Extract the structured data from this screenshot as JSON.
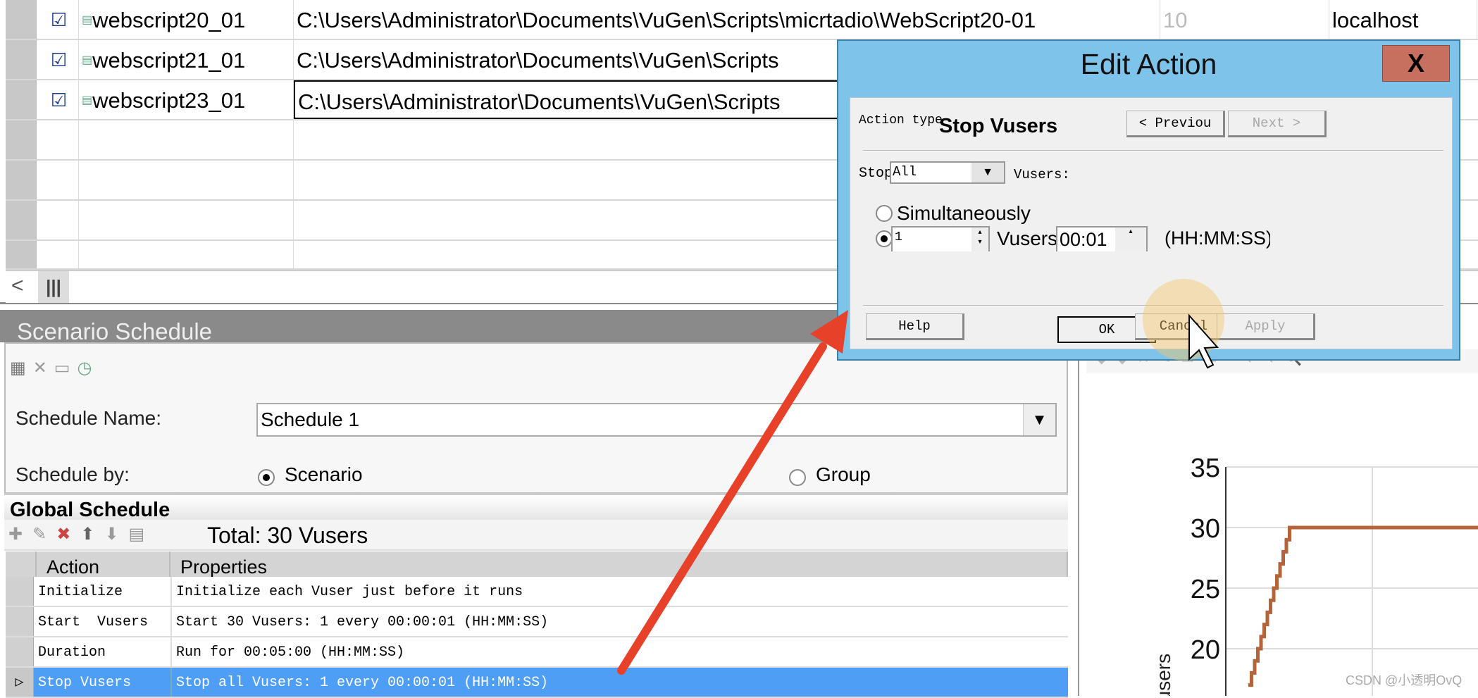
{
  "scripts_grid": {
    "rows": [
      {
        "checked": true,
        "name": "webscript20_01",
        "path": "C:\\Users\\Administrator\\Documents\\VuGen\\Scripts\\micrtadio\\WebScript20-01",
        "vusers": "10",
        "host": "localhost"
      },
      {
        "checked": true,
        "name": "webscript21_01",
        "path": "C:\\Users\\Administrator\\Documents\\VuGen\\Scripts",
        "vusers": "",
        "host": ""
      },
      {
        "checked": true,
        "name": "webscript23_01",
        "path": "C:\\Users\\Administrator\\Documents\\VuGen\\Scripts",
        "vusers": "",
        "host": ""
      }
    ],
    "scroll_left": "<",
    "scroll_thumb": "|||"
  },
  "scenario_schedule": {
    "title": "Scenario Schedule",
    "schedule_name_label": "Schedule Name:",
    "schedule_name_value": "Schedule 1",
    "schedule_by_label": "Schedule by:",
    "option_scenario": "Scenario",
    "option_group": "Group",
    "selected": "Scenario"
  },
  "global_schedule": {
    "title": "Global Schedule",
    "total": "Total: 30 Vusers",
    "columns": [
      "Action",
      "Properties"
    ],
    "rows": [
      {
        "action": "Initialize",
        "properties": "Initialize each Vuser just before it runs"
      },
      {
        "action": "Start  Vusers",
        "properties": "Start 30 Vusers: 1 every 00:00:01 (HH:MM:SS)"
      },
      {
        "action": "Duration",
        "properties": "Run for 00:05:00 (HH:MM:SS)"
      },
      {
        "action": "Stop Vusers",
        "properties": "Stop all Vusers: 1 every 00:00:01 (HH:MM:SS)",
        "selected": true
      }
    ]
  },
  "dialog": {
    "title": "Edit Action",
    "close": "X",
    "action_type_label": "Action type",
    "action_type_value": "Stop Vusers",
    "previous": "<  Previou",
    "next": "Next  >",
    "stop_label": "Stop",
    "stop_value": "All",
    "vusers_label": "Vusers:",
    "simultaneously": "Simultaneously",
    "count_value": "1",
    "vusers_every": "Vusers ev",
    "interval_value": "00:01",
    "interval_unit": "(HH:MM:SS)",
    "selected_mode": "every",
    "help": "Help",
    "ok": "OK",
    "cancel": "Cancel",
    "apply": "Apply"
  },
  "chart_data": {
    "type": "line",
    "ylabel": "Vusers",
    "y_ticks": [
      20,
      25,
      30,
      35
    ],
    "ylim": [
      17,
      35
    ],
    "grid": true,
    "series": [
      {
        "color": "#b5643a",
        "shape": "step ramp 1 Vuser per second up to 30, then flat",
        "values": [
          17,
          18,
          19,
          20,
          21,
          22,
          23,
          24,
          25,
          26,
          27,
          28,
          29,
          30,
          30,
          30,
          30,
          30,
          30,
          30,
          30,
          30,
          30,
          30,
          30,
          30
        ]
      }
    ]
  },
  "watermark": "CSDN @小透明OvQ",
  "colors": {
    "dialog_frame": "#7ec3ea",
    "close_button": "#c8705f",
    "selected_row": "#4f9ef5",
    "arrow": "#e8412a",
    "series": "#b5643a"
  }
}
